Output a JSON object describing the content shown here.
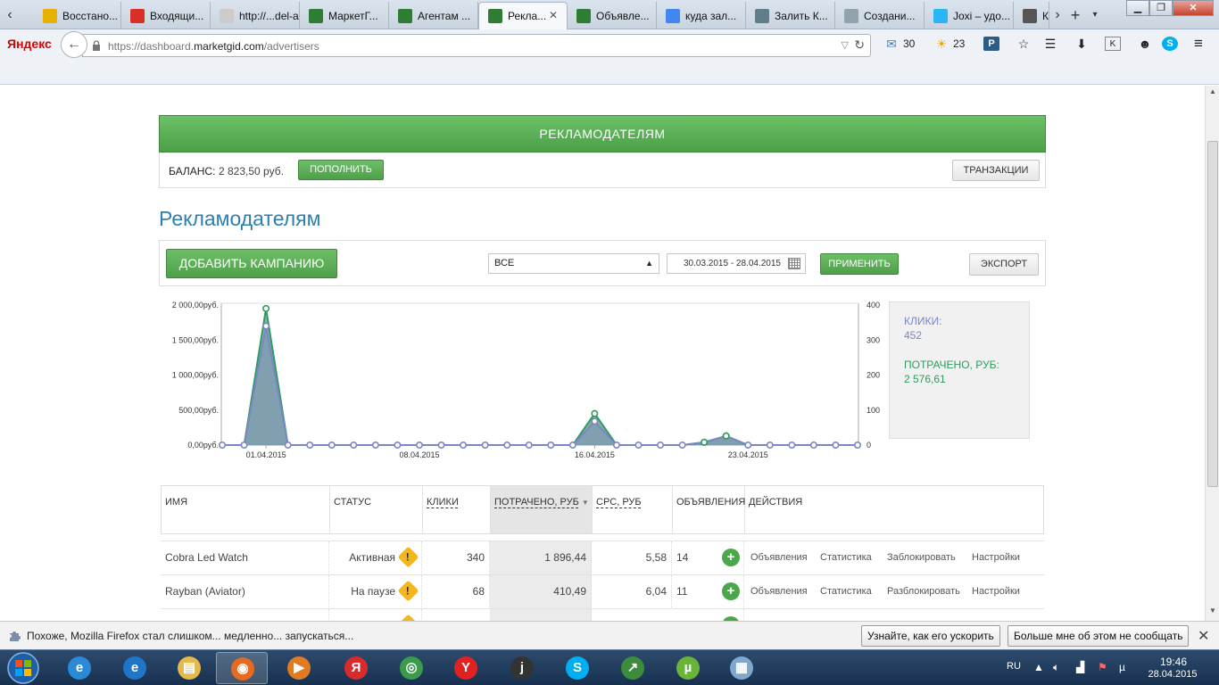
{
  "browser": {
    "tabs": [
      {
        "label": "Восстано...",
        "icon": "warning-icon",
        "color": "#e8b000"
      },
      {
        "label": "Входящи...",
        "icon": "gmail-icon",
        "color": "#d93025"
      },
      {
        "label": "http://...del-aff",
        "icon": "blank-icon",
        "color": "#ccc"
      },
      {
        "label": "МаркетГ...",
        "icon": "marketgid-icon",
        "color": "#2e7d32"
      },
      {
        "label": "Агентам ...",
        "icon": "marketgid-icon",
        "color": "#2e7d32"
      },
      {
        "label": "Рекла...",
        "icon": "marketgid-icon",
        "color": "#2e7d32"
      },
      {
        "label": "Объявле...",
        "icon": "marketgid-icon",
        "color": "#2e7d32"
      },
      {
        "label": "куда зал...",
        "icon": "google-icon",
        "color": "#4285f4"
      },
      {
        "label": "Залить К...",
        "icon": "upload-icon",
        "color": "#607d8b"
      },
      {
        "label": "Создани...",
        "icon": "page-icon",
        "color": "#90a4ae"
      },
      {
        "label": "Joxi – удо...",
        "icon": "joxi-icon",
        "color": "#29b6f6"
      },
      {
        "label": "К",
        "icon": "page-icon",
        "color": "#555"
      }
    ],
    "yandex_logo": "Яндекс",
    "url_prefix": "https://dashboard.",
    "url_host": "marketgid.com",
    "url_path": "/advertisers",
    "mail_count": "30",
    "weather_temp": "23"
  },
  "page": {
    "header_title": "РЕКЛАМОДАТЕЛЯМ",
    "balance_label": "БАЛАНС:",
    "balance_value": "2 823,50 руб.",
    "topup_label": "ПОПОЛНИТЬ",
    "transactions_label": "ТРАНЗАКЦИИ",
    "title": "Рекламодателям",
    "add_campaign_label": "ДОБАВИТЬ КАМПАНИЮ",
    "filter_value": "ВСЕ",
    "date_range": "30.03.2015 - 28.04.2015",
    "apply_label": "ПРИМЕНИТЬ",
    "export_label": "ЭКСПОРТ"
  },
  "stats": {
    "clicks_label": "КЛИКИ:",
    "clicks_value": "452",
    "spent_label": "ПОТРАЧЕНО, РУБ:",
    "spent_value": "2 576,61"
  },
  "chart_data": {
    "type": "area",
    "x": [
      "30.03.2015",
      "31.03.2015",
      "01.04.2015",
      "02.04.2015",
      "03.04.2015",
      "04.04.2015",
      "05.04.2015",
      "06.04.2015",
      "07.04.2015",
      "08.04.2015",
      "09.04.2015",
      "10.04.2015",
      "11.04.2015",
      "12.04.2015",
      "13.04.2015",
      "14.04.2015",
      "15.04.2015",
      "16.04.2015",
      "17.04.2015",
      "18.04.2015",
      "19.04.2015",
      "20.04.2015",
      "21.04.2015",
      "22.04.2015",
      "23.04.2015",
      "24.04.2015",
      "25.04.2015",
      "26.04.2015",
      "27.04.2015",
      "28.04.2015"
    ],
    "x_ticks": [
      "01.04.2015",
      "08.04.2015",
      "16.04.2015",
      "23.04.2015"
    ],
    "y_left_ticks": [
      "0,00руб.",
      "500,00руб.",
      "1 000,00руб.",
      "1 500,00руб.",
      "2 000,00руб."
    ],
    "y_right_ticks": [
      "0",
      "100",
      "200",
      "300",
      "400"
    ],
    "ylim_left": [
      0,
      2000
    ],
    "ylim_right": [
      0,
      400
    ],
    "series": [
      {
        "name": "КЛИКИ",
        "axis": "right",
        "color": "#7b86c6",
        "values": [
          0,
          0,
          340,
          0,
          0,
          0,
          0,
          0,
          0,
          0,
          0,
          0,
          0,
          0,
          0,
          0,
          0,
          68,
          0,
          0,
          0,
          0,
          8,
          26,
          0,
          0,
          0,
          0,
          0,
          0
        ]
      },
      {
        "name": "ПОТРАЧЕНО, РУБ",
        "axis": "left",
        "color": "#2f9b5e",
        "values": [
          0,
          0,
          1950,
          0,
          0,
          0,
          0,
          0,
          0,
          0,
          0,
          0,
          0,
          0,
          0,
          0,
          0,
          450,
          0,
          0,
          0,
          0,
          40,
          130,
          0,
          0,
          0,
          0,
          0,
          0
        ]
      }
    ]
  },
  "table": {
    "headers": {
      "name": "ИМЯ",
      "status": "СТАТУС",
      "clicks": "КЛИКИ",
      "spent": "ПОТРАЧЕНО, РУБ",
      "cpc": "CPC, РУБ",
      "ads": "ОБЪЯВЛЕНИЯ",
      "actions": "ДЕЙСТВИЯ"
    },
    "rows": [
      {
        "name": "Cobra Led Watch",
        "status": "Активная",
        "clicks": "340",
        "spent": "1 896,44",
        "cpc": "5,58",
        "ads": "14",
        "a1": "Объявления",
        "a2": "Статистика",
        "a3": "Заблокировать",
        "a4": "Настройки"
      },
      {
        "name": "Rayban (Aviator)",
        "status": "На паузе",
        "clicks": "68",
        "spent": "410,49",
        "cpc": "6,04",
        "ads": "11",
        "a1": "Объявления",
        "a2": "Статистика",
        "a3": "Разблокировать",
        "a4": "Настройки"
      }
    ]
  },
  "notification": {
    "text": "Похоже, Mozilla Firefox стал слишком... медленно... запускаться...",
    "learn_label": "Узнайте, как его ускорить",
    "dismiss_label": "Больше мне об этом не сообщать"
  },
  "taskbar": {
    "lang": "RU",
    "time": "19:46",
    "date": "28.04.2015",
    "apps": [
      {
        "name": "ie-icon",
        "color": "#2a8ad8",
        "glyph": "e"
      },
      {
        "name": "ie-icon",
        "color": "#1f76c9",
        "glyph": "e"
      },
      {
        "name": "explorer-icon",
        "color": "#e6b84a",
        "glyph": "▤"
      },
      {
        "name": "firefox-icon",
        "color": "#e66a1f",
        "glyph": "◉"
      },
      {
        "name": "media-player-icon",
        "color": "#e07b24",
        "glyph": "▶"
      },
      {
        "name": "yandex-browser-icon",
        "color": "#d92b2b",
        "glyph": "Я"
      },
      {
        "name": "chrome-icon",
        "color": "#3a9b4a",
        "glyph": "◎"
      },
      {
        "name": "yandex-icon",
        "color": "#e02222",
        "glyph": "Y"
      },
      {
        "name": "joxi-icon",
        "color": "#333333",
        "glyph": "j"
      },
      {
        "name": "skype-icon",
        "color": "#00aff0",
        "glyph": "S"
      },
      {
        "name": "chart-app-icon",
        "color": "#3c8c3c",
        "glyph": "↗"
      },
      {
        "name": "utorrent-icon",
        "color": "#6ab43a",
        "glyph": "µ"
      },
      {
        "name": "calculator-icon",
        "color": "#7fa8cf",
        "glyph": "▦"
      }
    ]
  }
}
